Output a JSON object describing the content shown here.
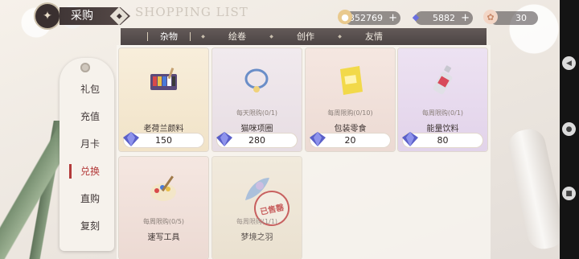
{
  "header": {
    "title": "采购",
    "title_badge_icon": "diamond-badge",
    "english_title": "SHOPPING LIST"
  },
  "currencies": [
    {
      "icon": "coin-icon",
      "value": "352769",
      "has_plus": true
    },
    {
      "icon": "diamond-icon",
      "value": "5882",
      "has_plus": true
    },
    {
      "icon": "star-token-icon",
      "value": "30",
      "has_plus": false
    }
  ],
  "tabs": [
    {
      "label": "杂物",
      "active": true
    },
    {
      "label": "绘卷",
      "active": false
    },
    {
      "label": "创作",
      "active": false
    },
    {
      "label": "友情",
      "active": false
    }
  ],
  "menu": [
    {
      "label": "礼包",
      "active": false
    },
    {
      "label": "充值",
      "active": false
    },
    {
      "label": "月卡",
      "active": false
    },
    {
      "label": "兑换",
      "active": true
    },
    {
      "label": "直购",
      "active": false
    },
    {
      "label": "复刻",
      "active": false
    }
  ],
  "items": [
    {
      "name": "老荷兰颜料",
      "limit": "",
      "price": "150",
      "art": "paint-set",
      "sold_out": false,
      "bg": "#f4e7cf"
    },
    {
      "name": "猫咪项圈",
      "limit": "每天限购(0/1)",
      "price": "280",
      "art": "cat-collar",
      "sold_out": false,
      "bg": "#ece4e8"
    },
    {
      "name": "包装零食",
      "limit": "每周限购(0/10)",
      "price": "20",
      "art": "snack-bag",
      "sold_out": false,
      "bg": "#f1e2dc"
    },
    {
      "name": "能量饮料",
      "limit": "每周限购(0/1)",
      "price": "80",
      "art": "energy-drink",
      "sold_out": false,
      "bg": "#e8dbef"
    },
    {
      "name": "速写工具",
      "limit": "每周限购(0/5)",
      "price": "",
      "art": "palette",
      "sold_out": false,
      "bg": "#f1e2dc"
    },
    {
      "name": "梦境之羽",
      "limit": "每周限购(1/1)",
      "price": "",
      "art": "dream-feather",
      "sold_out": true,
      "sold_label": "已售罄",
      "bg": "#eee5d6"
    }
  ],
  "colors": {
    "accent_red": "#b33a3a",
    "tab_bar": "#4c4444",
    "gem_blue": "#5a5fc8"
  }
}
